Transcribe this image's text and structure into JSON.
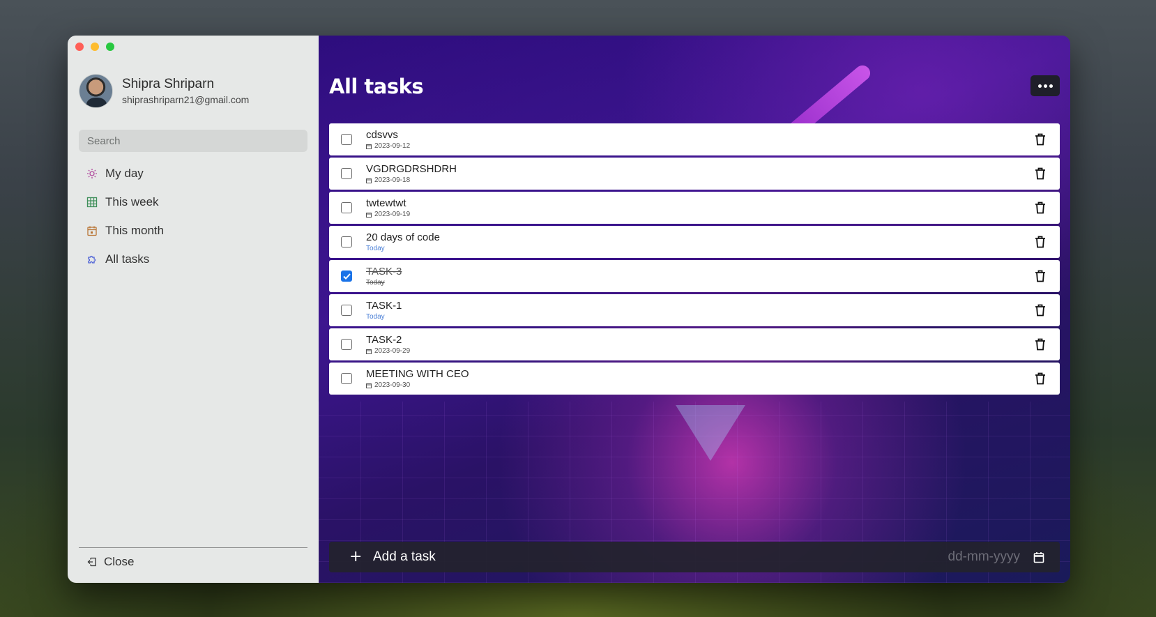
{
  "window": {
    "traffic_lights": [
      "close",
      "minimize",
      "maximize"
    ]
  },
  "profile": {
    "name": "Shipra Shriparn",
    "email": "shiprashriparn21@gmail.com"
  },
  "search": {
    "placeholder": "Search",
    "value": ""
  },
  "nav": {
    "items": [
      {
        "label": "My day",
        "icon": "sun-icon",
        "color": "#b0479c"
      },
      {
        "label": "This week",
        "icon": "grid-icon",
        "color": "#3f8f5a"
      },
      {
        "label": "This month",
        "icon": "calendar-icon",
        "color": "#b87333"
      },
      {
        "label": "All tasks",
        "icon": "puzzle-icon",
        "color": "#4a5fd6"
      }
    ]
  },
  "sidebar_footer": {
    "close_label": "Close"
  },
  "main": {
    "title": "All tasks",
    "more_icon": "ellipsis-icon"
  },
  "tasks": [
    {
      "title": "cdsvvs",
      "date": "2023-09-12",
      "done": false,
      "today": false
    },
    {
      "title": "VGDRGDRSHDRH",
      "date": "2023-09-18",
      "done": false,
      "today": false
    },
    {
      "title": "twtewtwt",
      "date": "2023-09-19",
      "done": false,
      "today": false
    },
    {
      "title": "20 days of code",
      "date": "Today",
      "done": false,
      "today": true
    },
    {
      "title": "TASK-3",
      "date": "Today",
      "done": true,
      "today": true
    },
    {
      "title": "TASK-1",
      "date": "Today",
      "done": false,
      "today": true
    },
    {
      "title": "TASK-2",
      "date": "2023-09-29",
      "done": false,
      "today": false
    },
    {
      "title": "MEETING WITH CEO",
      "date": "2023-09-30",
      "done": false,
      "today": false
    }
  ],
  "add_task": {
    "placeholder": "Add a task",
    "date_placeholder": "dd-mm-yyyy"
  },
  "colors": {
    "sidebar_bg": "#e6e8e7",
    "checkbox_checked": "#1a73e8",
    "today_text": "#4a7fd6"
  }
}
